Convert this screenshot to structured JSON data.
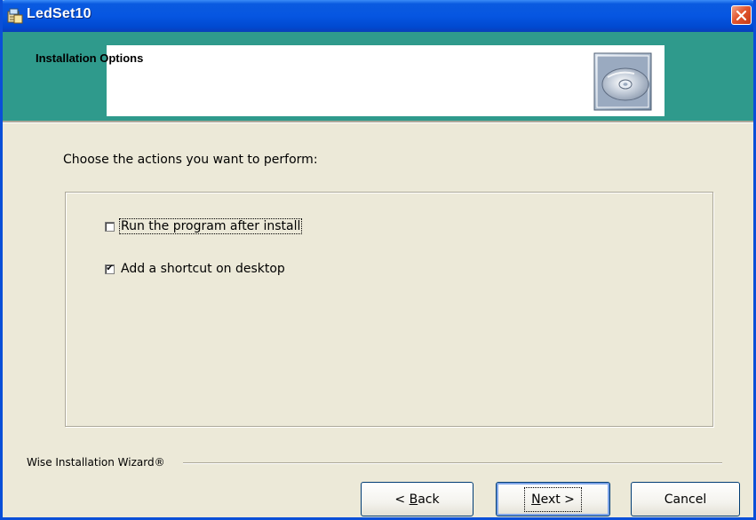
{
  "window": {
    "title": "LedSet10",
    "app_icon": "installer-icon",
    "close_icon": "close-icon"
  },
  "header": {
    "title": "Installation Options",
    "icon": "cd-disc-icon",
    "band_color": "#2f9a8c"
  },
  "body": {
    "prompt": "Choose the actions you want to perform:",
    "options": [
      {
        "label": "Run the program after install",
        "checked": false,
        "focused": true
      },
      {
        "label": "Add a shortcut on desktop",
        "checked": true,
        "focused": false
      }
    ]
  },
  "footer": {
    "brand": "Wise Installation Wizard®",
    "back_prefix": "< ",
    "back_mnemonic": "B",
    "back_rest": "ack",
    "next_mnemonic": "N",
    "next_rest": "ext >",
    "cancel_label": "Cancel"
  },
  "check_mark": "✔"
}
